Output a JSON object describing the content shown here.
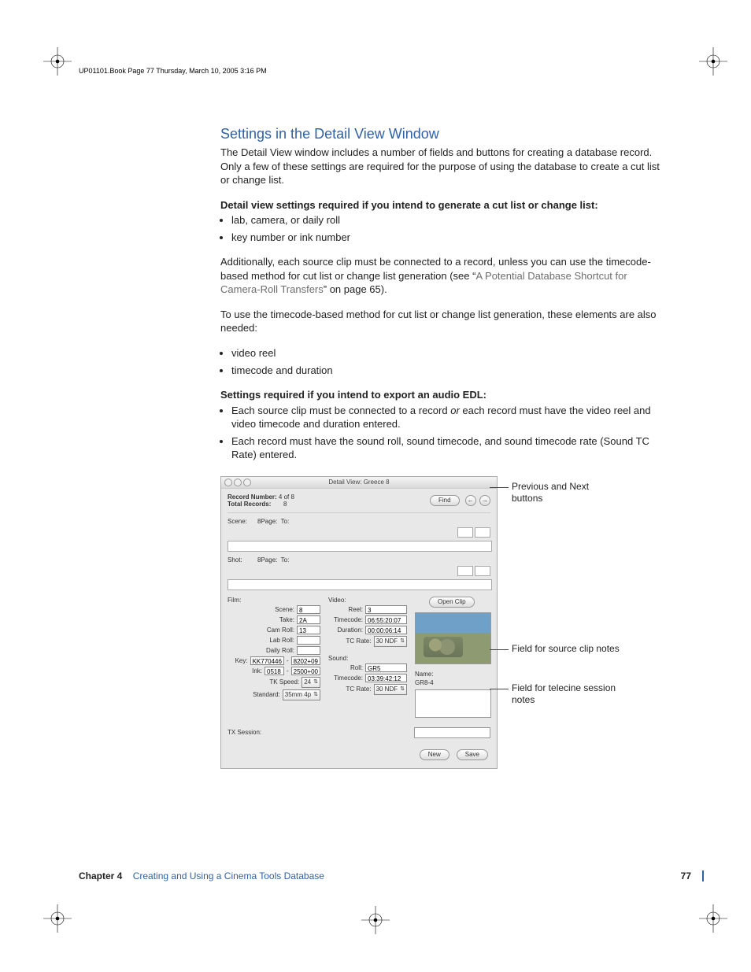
{
  "slug": "UP01101.Book  Page 77  Thursday, March 10, 2005  3:16 PM",
  "section_title": "Settings in the Detail View Window",
  "intro": "The Detail View window includes a number of fields and buttons for creating a database record. Only a few of these settings are required for the purpose of using the database to create a cut list or change list.",
  "sub1": "Detail view settings required if you intend to generate a cut list or change list:",
  "b1a": "lab, camera, or daily roll",
  "b1b": "key number or ink number",
  "para2a": "Additionally, each source clip must be connected to a record, unless you can use the timecode-based method for cut list or change list generation (see “",
  "xref": "A Potential Database Shortcut for Camera-Roll Transfers",
  "para2b": "” on page 65).",
  "para3": "To use the timecode-based method for cut list or change list generation, these elements are also needed:",
  "b2a": "video reel",
  "b2b": "timecode and duration",
  "sub2": "Settings required if you intend to export an audio EDL:",
  "b3a_pre": "Each source clip must be connected to a record ",
  "b3a_or": "or",
  "b3a_post": " each record must have the video reel and video timecode and duration entered.",
  "b3b": "Each record must have the sound roll, sound timecode, and sound timecode rate (Sound TC Rate) entered.",
  "callouts": {
    "prevnext": "Previous and Next buttons",
    "clipnotes": "Field for source clip notes",
    "txnotes": "Field for telecine session notes"
  },
  "dv": {
    "title": "Detail View: Greece 8",
    "record_number_label": "Record Number:",
    "record_number_value": "4 of 8",
    "total_records_label": "Total Records:",
    "total_records_value": "8",
    "find": "Find",
    "prev": "←",
    "next": "→",
    "scene_label": "Scene:",
    "scene_value": "8",
    "shot_label": "Shot:",
    "shot_value": "8",
    "page_label": "Page:",
    "to_label": "To:",
    "film": {
      "head": "Film:",
      "scene": "Scene:",
      "scene_v": "8",
      "take": "Take:",
      "take_v": "2A",
      "camroll": "Cam Roll:",
      "camroll_v": "13",
      "labroll": "Lab Roll:",
      "dailyroll": "Daily Roll:",
      "key": "Key:",
      "key_v1": "KK770446",
      "key_v2": "8202+09",
      "ink": "Ink:",
      "ink_v1": "0518",
      "ink_v2": "2500+00",
      "tkspeed": "TK Speed:",
      "tkspeed_v": "24",
      "standard": "Standard:",
      "standard_v": "35mm 4p"
    },
    "video": {
      "head": "Video:",
      "reel": "Reel:",
      "reel_v": "3",
      "tc": "Timecode:",
      "tc_v": "06:55:20:07",
      "dur": "Duration:",
      "dur_v": "00:00:06:14",
      "rate": "TC Rate:",
      "rate_v": "30 NDF"
    },
    "sound": {
      "head": "Sound:",
      "roll": "Roll:",
      "roll_v": "GR5",
      "tc": "Timecode:",
      "tc_v": "03:39:42:12",
      "rate": "TC Rate:",
      "rate_v": "30 NDF"
    },
    "openclip": "Open Clip",
    "name_label": "Name:",
    "name_value": "GR8-4",
    "tx_label": "TX Session:",
    "new": "New",
    "save": "Save"
  },
  "footer": {
    "chapter": "Chapter 4",
    "title": "Creating and Using a Cinema Tools Database",
    "page": "77"
  }
}
